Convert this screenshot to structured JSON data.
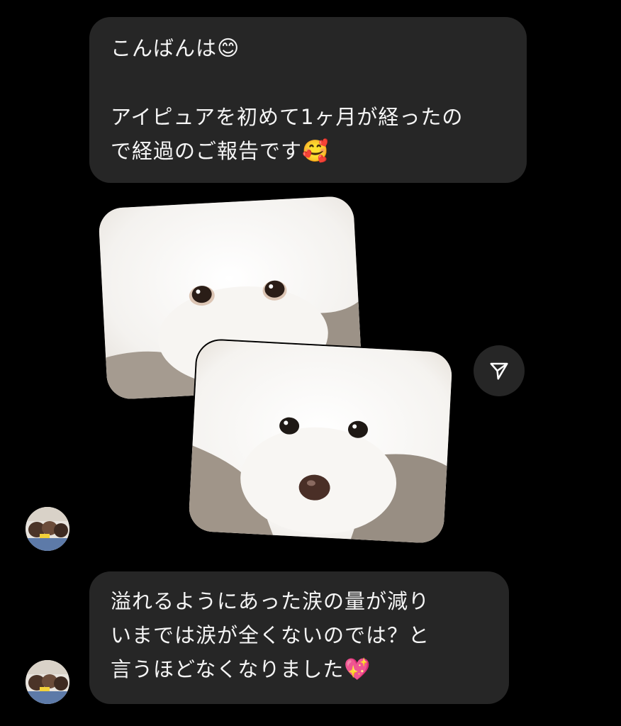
{
  "messages": [
    {
      "sender": "other",
      "lines": [
        "こんばんは",
        "",
        "アイピュアを初めて1ヶ月が経ったの",
        "で経過のご報告です"
      ],
      "emojis": {
        "line0": "😊",
        "line3": "🥰"
      }
    },
    {
      "sender": "other",
      "type": "photos",
      "photos": [
        {
          "subject": "white poodle face close-up"
        },
        {
          "subject": "white poodle face close-up resting"
        }
      ]
    },
    {
      "sender": "other",
      "lines": [
        "溢れるようにあった涙の量が減り",
        "いまでは涙が全くないのでは？と",
        "言うほどなくなりました"
      ],
      "emojis": {
        "line2": "💖"
      }
    }
  ],
  "icons": {
    "share": "send-icon",
    "avatar": "profile-avatar"
  },
  "colors": {
    "background": "#000000",
    "bubble": "#262626",
    "text": "#f5f5f5"
  }
}
